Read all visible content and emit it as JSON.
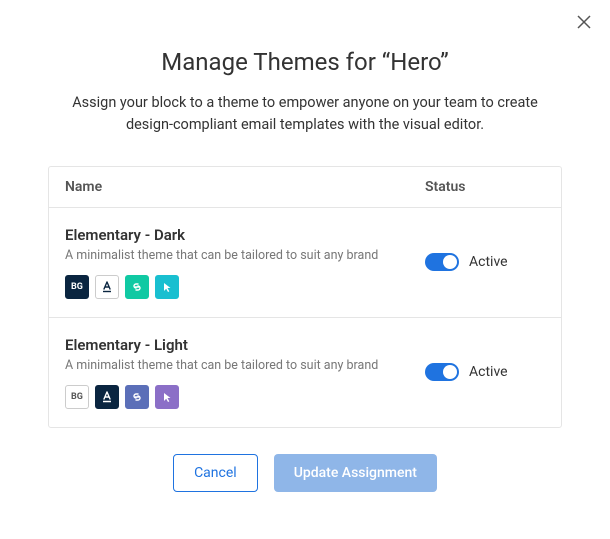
{
  "modal": {
    "title": "Manage Themes for “Hero”",
    "subtitle": "Assign your block to a theme to empower anyone on your team to create design-compliant email templates with the visual editor."
  },
  "table": {
    "headers": {
      "name": "Name",
      "status": "Status"
    }
  },
  "themes": [
    {
      "name": "Elementary - Dark",
      "description": "A minimalist theme that can be tailored to suit any brand",
      "status_label": "Active",
      "active": true,
      "swatches": {
        "bg": {
          "label": "BG",
          "bg": "#0a2540",
          "fg": "#ffffff",
          "border": "#0a2540"
        },
        "text": {
          "bg": "#ffffff",
          "fg": "#0a2540",
          "border": "#cccccc"
        },
        "link": {
          "bg": "#10c9a3",
          "fg": "#ffffff",
          "border": "#10c9a3"
        },
        "cursor": {
          "bg": "#19bfd0",
          "fg": "#ffffff",
          "border": "#19bfd0"
        }
      }
    },
    {
      "name": "Elementary - Light",
      "description": "A minimalist theme that can be tailored to suit any brand",
      "status_label": "Active",
      "active": true,
      "swatches": {
        "bg": {
          "label": "BG",
          "bg": "#ffffff",
          "fg": "#555555",
          "border": "#cccccc"
        },
        "text": {
          "bg": "#0a2540",
          "fg": "#ffffff",
          "border": "#0a2540"
        },
        "link": {
          "bg": "#5b6fb8",
          "fg": "#ffffff",
          "border": "#5b6fb8"
        },
        "cursor": {
          "bg": "#8b6fc7",
          "fg": "#ffffff",
          "border": "#8b6fc7"
        }
      }
    }
  ],
  "buttons": {
    "cancel": "Cancel",
    "update": "Update Assignment"
  }
}
